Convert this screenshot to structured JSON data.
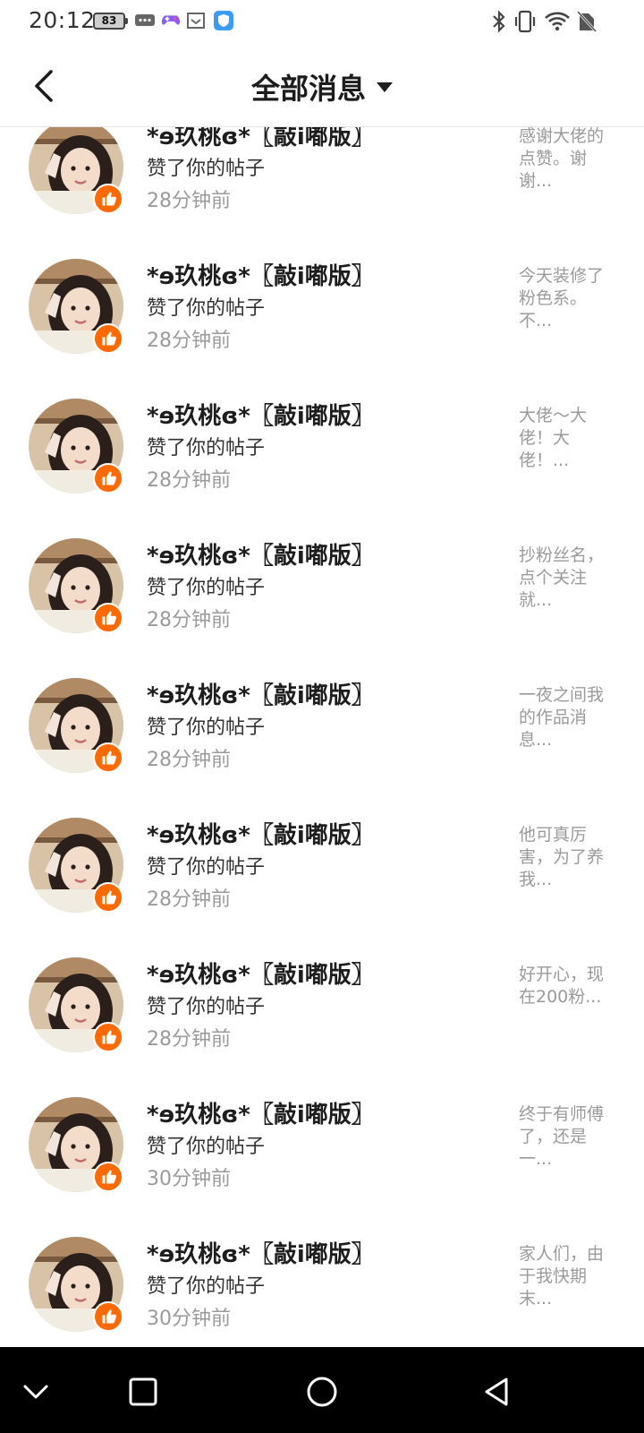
{
  "status_bar": {
    "time": "20:12",
    "battery": "83",
    "left_icons": [
      "battery-icon",
      "chat-bubble-icon",
      "game-controller-icon",
      "screenshot-icon",
      "shield-app-icon"
    ],
    "right_icons": [
      "bluetooth-icon",
      "vibrate-icon",
      "wifi-icon",
      "no-sim-icon"
    ]
  },
  "header": {
    "title": "全部消息",
    "back_icon": "chevron-left-icon",
    "dropdown_icon": "caret-down-icon"
  },
  "theme": {
    "accent": "#ff6a00",
    "text_primary": "#1d1d1d",
    "text_secondary": "#9a9a9a"
  },
  "notifications": [
    {
      "user": "*ɘ玖桃ɞ*〖敲i嘟版〗",
      "action": "赞了你的帖子",
      "time": "28分钟前",
      "preview": "感谢大佬的点赞。谢谢..."
    },
    {
      "user": "*ɘ玖桃ɞ*〖敲i嘟版〗",
      "action": "赞了你的帖子",
      "time": "28分钟前",
      "preview": "今天装修了粉色系。不..."
    },
    {
      "user": "*ɘ玖桃ɞ*〖敲i嘟版〗",
      "action": "赞了你的帖子",
      "time": "28分钟前",
      "preview": " 大佬～大佬！大佬！..."
    },
    {
      "user": "*ɘ玖桃ɞ*〖敲i嘟版〗",
      "action": "赞了你的帖子",
      "time": "28分钟前",
      "preview": "抄粉丝名，点个关注就..."
    },
    {
      "user": "*ɘ玖桃ɞ*〖敲i嘟版〗",
      "action": "赞了你的帖子",
      "time": "28分钟前",
      "preview": "一夜之间我的作品消息..."
    },
    {
      "user": "*ɘ玖桃ɞ*〖敲i嘟版〗",
      "action": "赞了你的帖子",
      "time": "28分钟前",
      "preview": "他可真厉害，为了养我..."
    },
    {
      "user": "*ɘ玖桃ɞ*〖敲i嘟版〗",
      "action": "赞了你的帖子",
      "time": "28分钟前",
      "preview": "好开心，现在200粉..."
    },
    {
      "user": "*ɘ玖桃ɞ*〖敲i嘟版〗",
      "action": "赞了你的帖子",
      "time": "30分钟前",
      "preview": "终于有师傅了，还是一..."
    },
    {
      "user": "*ɘ玖桃ɞ*〖敲i嘟版〗",
      "action": "赞了你的帖子",
      "time": "30分钟前",
      "preview": "家人们，由于我快期末..."
    }
  ],
  "nav_bar": {
    "icons": [
      "collapse-chevron-icon",
      "recents-square-icon",
      "home-circle-icon",
      "back-triangle-icon"
    ]
  }
}
